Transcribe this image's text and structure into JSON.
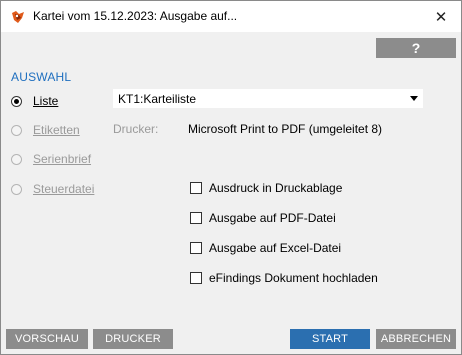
{
  "window": {
    "title": "Kartei vom 15.12.2023: Ausgabe auf...",
    "close_glyph": "✕"
  },
  "help_button": {
    "label": "?"
  },
  "selection": {
    "section_label": "AUSWAHL",
    "options": [
      {
        "label": "Liste",
        "checked": true,
        "enabled": true
      },
      {
        "label": "Etiketten",
        "checked": false,
        "enabled": false
      },
      {
        "label": "Serienbrief",
        "checked": false,
        "enabled": false
      },
      {
        "label": "Steuerdatei",
        "checked": false,
        "enabled": false
      }
    ]
  },
  "list_select": {
    "value": "KT1:Karteiliste"
  },
  "printer": {
    "label": "Drucker:",
    "value": "Microsoft Print to PDF (umgeleitet 8)"
  },
  "checkboxes": [
    {
      "label": "Ausdruck in Druckablage",
      "checked": false
    },
    {
      "label": "Ausgabe auf PDF-Datei",
      "checked": false
    },
    {
      "label": "Ausgabe auf Excel-Datei",
      "checked": false
    },
    {
      "label": "eFindings Dokument hochladen",
      "checked": false
    }
  ],
  "buttons": {
    "preview": "VORSCHAU",
    "printer": "DRUCKER",
    "start": "START",
    "cancel": "ABBRECHEN"
  },
  "colors": {
    "accent_blue": "#2b6fb0",
    "section_label_blue": "#1f6fbf",
    "button_gray": "#8c8c8c",
    "dialog_background": "#f0f0f0"
  },
  "icons": {
    "app": "app-logo-icon",
    "close": "close-icon",
    "dropdown": "chevron-down-icon"
  }
}
